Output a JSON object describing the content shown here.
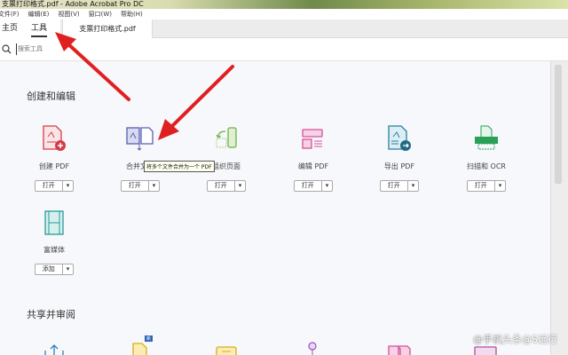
{
  "window": {
    "title": "支票打印格式.pdf - Adobe Acrobat Pro DC"
  },
  "menu": [
    "文件(F)",
    "编辑(E)",
    "视图(V)",
    "窗口(W)",
    "帮助(H)"
  ],
  "tabs": {
    "home": "主页",
    "tools": "工具",
    "document": "支票打印格式.pdf"
  },
  "search": {
    "placeholder": "搜索工具"
  },
  "sections": {
    "create_edit": "创建和编辑",
    "share_review": "共享并审阅"
  },
  "tools": [
    {
      "label": "创建 PDF",
      "button": "打开",
      "icon": "create-pdf-icon"
    },
    {
      "label": "合并文件",
      "button": "打开",
      "icon": "combine-files-icon"
    },
    {
      "label": "组织页面",
      "button": "打开",
      "icon": "organize-pages-icon"
    },
    {
      "label": "编辑 PDF",
      "button": "打开",
      "icon": "edit-pdf-icon"
    },
    {
      "label": "导出 PDF",
      "button": "打开",
      "icon": "export-pdf-icon"
    },
    {
      "label": "扫描和 OCR",
      "button": "打开",
      "icon": "scan-ocr-icon"
    },
    {
      "label": "富媒体",
      "button": "添加",
      "icon": "rich-media-icon"
    }
  ],
  "tooltip": "将多个文件合并为一个 PDF",
  "badge_new": "新",
  "watermark": {
    "dim": "@手机",
    "main": "头条@S远行"
  },
  "colors": {
    "arrow": "#e02020",
    "create": "#d23c4a",
    "combine": "#5a5fb0",
    "organize": "#6db24a",
    "edit": "#d44f9c",
    "export": "#2a7f9e",
    "scan": "#2aa057",
    "media": "#2a9a9a"
  }
}
